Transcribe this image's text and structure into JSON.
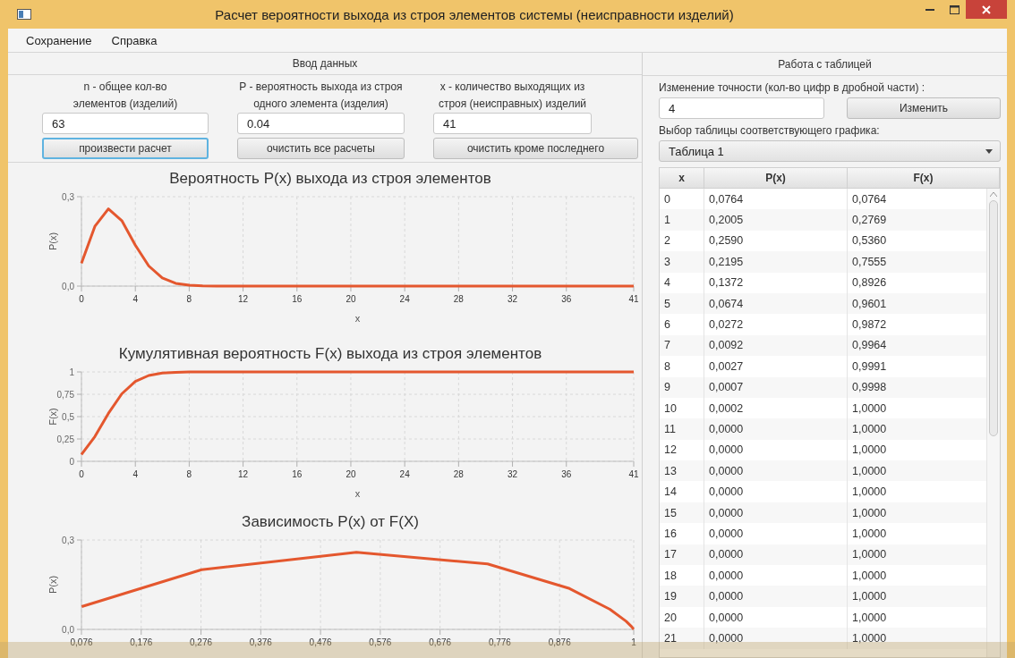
{
  "window": {
    "title": "Расчет вероятности выхода из строя элементов системы (неисправности изделий)"
  },
  "menu": [
    "Сохранение",
    "Справка"
  ],
  "input_panel": {
    "title": "Ввод данных",
    "fields": [
      {
        "label": "n - общее кол-во элементов (изделий)",
        "value": "63"
      },
      {
        "label": "P - вероятность выхода из строя одного элемента (изделия)",
        "value": "0.04"
      },
      {
        "label": "x - количество выходящих из строя (неисправных) изделий",
        "value": "41"
      }
    ],
    "buttons": [
      {
        "label": "произвести расчет",
        "focused": true
      },
      {
        "label": "очистить все расчеты",
        "focused": false
      },
      {
        "label": "очистить кроме последнего",
        "focused": false
      }
    ]
  },
  "table_panel": {
    "title": "Работа с таблицей",
    "precision_label": "Изменение точности (кол-во цифр в дробной части) :",
    "precision_value": "4",
    "apply_button": "Изменить",
    "select_label": "Выбор таблицы соответствующего графика:",
    "select_value": "Таблица 1"
  },
  "charts": [
    {
      "chart_data": {
        "type": "line",
        "title": "Вероятность P(x) выхода из строя элементов",
        "xlabel": "x",
        "ylabel": "P(x)",
        "x": [
          0,
          1,
          2,
          3,
          4,
          5,
          6,
          7,
          8,
          9,
          10,
          11,
          12,
          13,
          14,
          15,
          16,
          17,
          18,
          19,
          20,
          21,
          22,
          23,
          24,
          25,
          26,
          27,
          28,
          29,
          30,
          31,
          32,
          33,
          34,
          35,
          36,
          37,
          38,
          39,
          40,
          41
        ],
        "series": [
          {
            "color": "#e4572e",
            "values": [
              0.0764,
              0.2005,
              0.259,
              0.2195,
              0.1372,
              0.0674,
              0.0272,
              0.0092,
              0.0027,
              0.0007,
              0.0002,
              0,
              0,
              0,
              0,
              0,
              0,
              0,
              0,
              0,
              0,
              0,
              0,
              0,
              0,
              0,
              0,
              0,
              0,
              0,
              0,
              0,
              0,
              0,
              0,
              0,
              0,
              0,
              0,
              0,
              0,
              0
            ]
          }
        ],
        "xlim": [
          0,
          41
        ],
        "ylim": [
          0,
          0.3
        ],
        "xticks": [
          0,
          4,
          8,
          12,
          16,
          20,
          24,
          28,
          32,
          36,
          41
        ],
        "grid": true,
        "yticks": [
          {
            "value": 0,
            "label": "0,0"
          },
          {
            "value": 0.3,
            "label": "0,3"
          }
        ]
      }
    },
    {
      "chart_data": {
        "type": "line",
        "title": "Кумулятивная вероятность F(x) выхода из строя элементов",
        "xlabel": "x",
        "ylabel": "F(x)",
        "x": [
          0,
          1,
          2,
          3,
          4,
          5,
          6,
          7,
          8,
          9,
          10,
          11,
          12,
          13,
          14,
          15,
          16,
          17,
          18,
          19,
          20,
          21,
          22,
          23,
          24,
          25,
          26,
          27,
          28,
          29,
          30,
          31,
          32,
          33,
          34,
          35,
          36,
          37,
          38,
          39,
          40,
          41
        ],
        "series": [
          {
            "color": "#e4572e",
            "values": [
              0.0764,
              0.2769,
              0.536,
              0.7555,
              0.8926,
              0.9601,
              0.9872,
              0.9964,
              0.9991,
              0.9998,
              1,
              1,
              1,
              1,
              1,
              1,
              1,
              1,
              1,
              1,
              1,
              1,
              1,
              1,
              1,
              1,
              1,
              1,
              1,
              1,
              1,
              1,
              1,
              1,
              1,
              1,
              1,
              1,
              1,
              1,
              1,
              1
            ]
          }
        ],
        "xlim": [
          0,
          41
        ],
        "ylim": [
          0,
          1
        ],
        "xticks": [
          0,
          4,
          8,
          12,
          16,
          20,
          24,
          28,
          32,
          36,
          41
        ],
        "grid": true,
        "yticks": [
          {
            "value": 0,
            "label": "0"
          },
          {
            "value": 0.25,
            "label": "0,25"
          },
          {
            "value": 0.5,
            "label": "0,5"
          },
          {
            "value": 0.75,
            "label": "0,75"
          },
          {
            "value": 1,
            "label": "1"
          }
        ]
      }
    },
    {
      "chart_data": {
        "type": "line",
        "title": "Зависимость P(x) от F(X)",
        "ylabel": "P(x)",
        "x": [
          0.0764,
          0.2769,
          0.536,
          0.7555,
          0.8926,
          0.9601,
          0.9872,
          0.9964,
          0.9991,
          0.9998,
          1
        ],
        "series": [
          {
            "color": "#e4572e",
            "values": [
              0.0764,
              0.2005,
              0.259,
              0.2195,
              0.1372,
              0.0674,
              0.0272,
              0.0092,
              0.0027,
              0.0007,
              0.0002
            ]
          }
        ],
        "xlim": [
          0.076,
          1
        ],
        "ylim": [
          0,
          0.3
        ],
        "grid": true,
        "xticks": [
          {
            "value": 0.076,
            "label": "0,076"
          },
          {
            "value": 0.176,
            "label": "0,176"
          },
          {
            "value": 0.276,
            "label": "0,276"
          },
          {
            "value": 0.376,
            "label": "0,376"
          },
          {
            "value": 0.476,
            "label": "0,476"
          },
          {
            "value": 0.576,
            "label": "0,576"
          },
          {
            "value": 0.676,
            "label": "0,676"
          },
          {
            "value": 0.776,
            "label": "0,776"
          },
          {
            "value": 0.876,
            "label": "0,876"
          },
          {
            "value": 1,
            "label": "1"
          }
        ],
        "yticks": [
          {
            "value": 0,
            "label": "0,0"
          },
          {
            "value": 0.3,
            "label": "0,3"
          }
        ]
      }
    }
  ],
  "table": {
    "columns": [
      "x",
      "P(x)",
      "F(x)"
    ],
    "rows": [
      [
        "0",
        "0,0764",
        "0,0764"
      ],
      [
        "1",
        "0,2005",
        "0,2769"
      ],
      [
        "2",
        "0,2590",
        "0,5360"
      ],
      [
        "3",
        "0,2195",
        "0,7555"
      ],
      [
        "4",
        "0,1372",
        "0,8926"
      ],
      [
        "5",
        "0,0674",
        "0,9601"
      ],
      [
        "6",
        "0,0272",
        "0,9872"
      ],
      [
        "7",
        "0,0092",
        "0,9964"
      ],
      [
        "8",
        "0,0027",
        "0,9991"
      ],
      [
        "9",
        "0,0007",
        "0,9998"
      ],
      [
        "10",
        "0,0002",
        "1,0000"
      ],
      [
        "11",
        "0,0000",
        "1,0000"
      ],
      [
        "12",
        "0,0000",
        "1,0000"
      ],
      [
        "13",
        "0,0000",
        "1,0000"
      ],
      [
        "14",
        "0,0000",
        "1,0000"
      ],
      [
        "15",
        "0,0000",
        "1,0000"
      ],
      [
        "16",
        "0,0000",
        "1,0000"
      ],
      [
        "17",
        "0,0000",
        "1,0000"
      ],
      [
        "18",
        "0,0000",
        "1,0000"
      ],
      [
        "19",
        "0,0000",
        "1,0000"
      ],
      [
        "20",
        "0,0000",
        "1,0000"
      ],
      [
        "21",
        "0,0000",
        "1,0000"
      ]
    ]
  }
}
